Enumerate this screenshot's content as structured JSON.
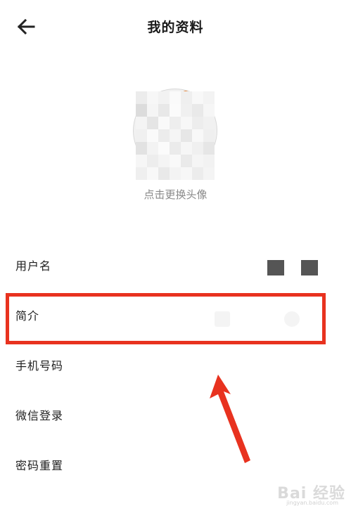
{
  "header": {
    "title": "我的资料",
    "back_icon": "arrow-left-icon"
  },
  "avatar": {
    "hint": "点击更换头像"
  },
  "list": {
    "username_label": "用户名",
    "intro_label": "简介",
    "phone_label": "手机号码",
    "wechat_label": "微信登录",
    "password_label": "密码重置"
  },
  "annotation": {
    "highlight_color": "#e8321f",
    "arrow_color": "#e8321f"
  },
  "watermark": {
    "brand": "Bai 经验",
    "url": "jingyan.baidu.com"
  }
}
